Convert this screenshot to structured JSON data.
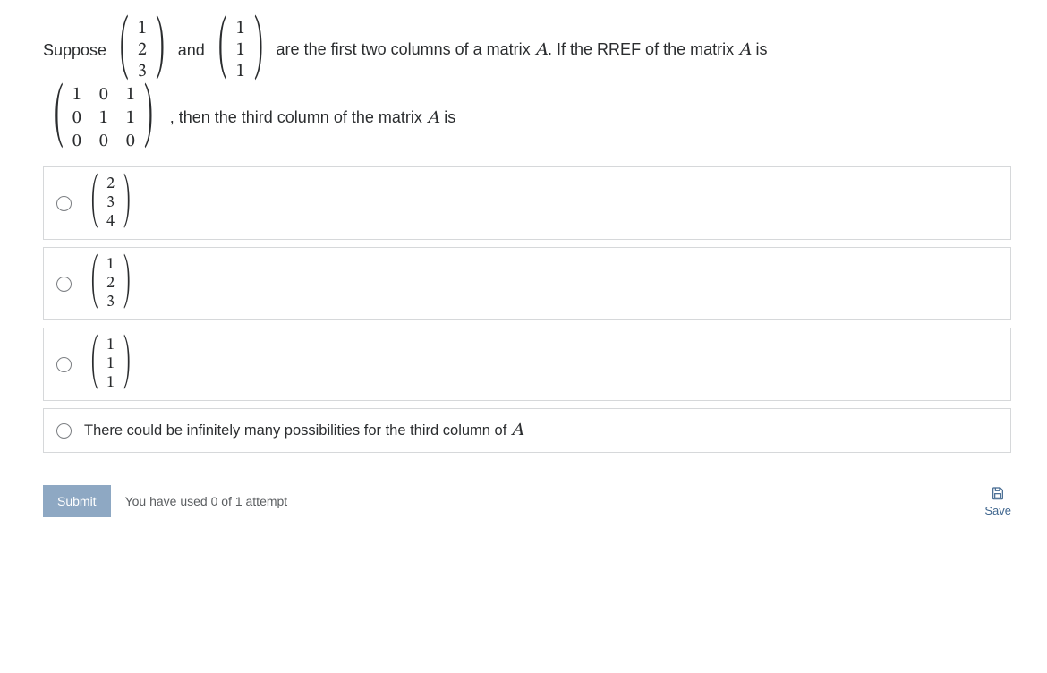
{
  "stem": {
    "t1": "Suppose",
    "v1": [
      "1",
      "2",
      "3"
    ],
    "t2": "and",
    "v2": [
      "1",
      "1",
      "1"
    ],
    "t3a": "are the first two columns of a matrix ",
    "A": "A",
    "t3b": ". If the RREF of the matrix ",
    "t3c": " is",
    "mat": [
      [
        "1",
        "0",
        "1"
      ],
      [
        "0",
        "1",
        "1"
      ],
      [
        "0",
        "0",
        "0"
      ]
    ],
    "t4": ", then the third column of the matrix ",
    "t5": " is"
  },
  "options": {
    "o1": [
      "2",
      "3",
      "4"
    ],
    "o2": [
      "1",
      "2",
      "3"
    ],
    "o3": [
      "1",
      "1",
      "1"
    ],
    "o4_text": "There could be infinitely many possibilities for the third column of ",
    "o4_A": "A"
  },
  "footer": {
    "submit": "Submit",
    "attempts": "You have used 0 of 1 attempt",
    "save": "Save"
  }
}
